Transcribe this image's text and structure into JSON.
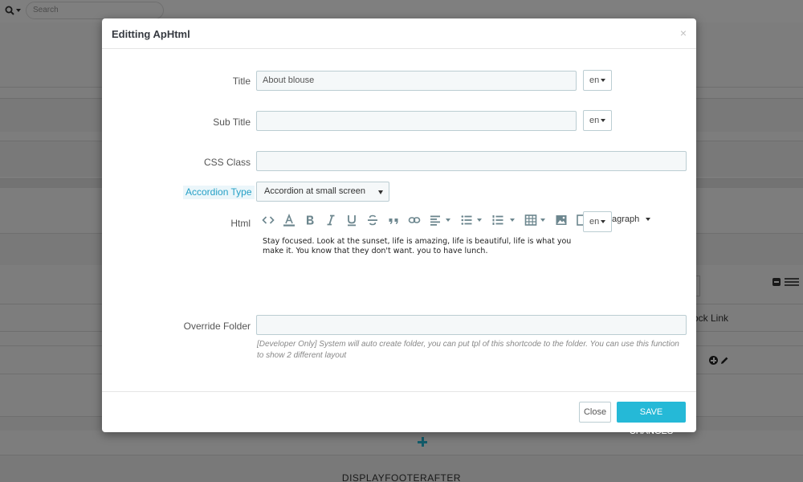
{
  "background": {
    "search_placeholder": "Search",
    "block_link_label": "ock Link",
    "footer_section": "DISPLAYFOOTERAFTER"
  },
  "modal": {
    "title": "Editting ApHtml",
    "close_glyph": "×",
    "fields": {
      "title": {
        "label": "Title",
        "value": "About blouse",
        "lang": "en"
      },
      "sub_title": {
        "label": "Sub Title",
        "value": "",
        "lang": "en"
      },
      "css_class": {
        "label": "CSS Class",
        "value": ""
      },
      "accordion_type": {
        "label": "Accordion Type",
        "selected": "Accordion at small screen"
      },
      "html": {
        "label": "Html",
        "lang": "en",
        "format_label": "agraph",
        "content_line1": "Stay focused. Look at the sunset, life is amazing, life is beautiful, life is what you",
        "content_line2": "make it. You know that they don't want. you to have lunch."
      },
      "override_folder": {
        "label": "Override Folder",
        "value": "",
        "help": "[Developer Only] System will auto create folder, you can put tpl of this shortcode to the folder. You can use this function to show 2 different layout"
      }
    },
    "toolbar_icons": [
      "code-icon",
      "text-color-icon",
      "bold-icon",
      "italic-icon",
      "underline-icon",
      "strikethrough-icon",
      "blockquote-icon",
      "link-icon",
      "align-icon",
      "bullet-list-icon",
      "numbered-list-icon",
      "table-icon",
      "image-icon"
    ],
    "buttons": {
      "close": "Close",
      "save": "SAVE CHANGES"
    }
  },
  "colors": {
    "accent": "#25b9d7",
    "input_border": "#bbcdd2",
    "input_bg": "#f5f8f9",
    "accordion_highlight": "#ebf6fa"
  }
}
